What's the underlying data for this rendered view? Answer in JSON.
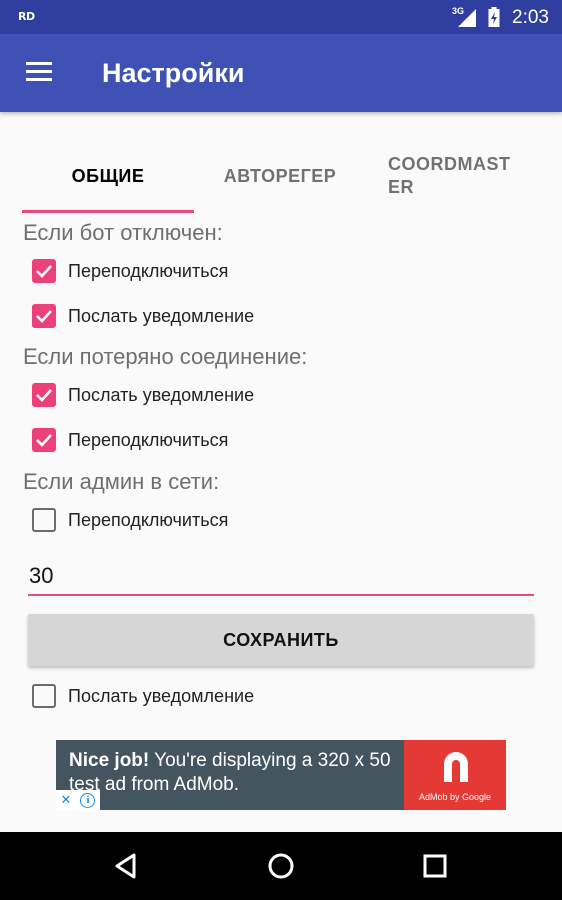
{
  "status_bar": {
    "carrier": "RD",
    "network": "3G",
    "time": "2:03",
    "icons": [
      "signal-icon",
      "battery-icon"
    ]
  },
  "app_bar": {
    "title": "Настройки",
    "menu_icon": "hamburger-menu-icon"
  },
  "tabs": [
    {
      "label": "ОБЩИЕ",
      "active": true
    },
    {
      "label": "АВТОРЕГЕР",
      "active": false
    },
    {
      "label": "COORDMASTER",
      "active": false
    }
  ],
  "sections": {
    "bot_disconnected": {
      "title": "Если бот отключен:",
      "options": [
        {
          "label": "Переподключиться",
          "checked": true
        },
        {
          "label": "Послать уведомление",
          "checked": true
        }
      ]
    },
    "connection_lost": {
      "title": "Если потеряно соединение:",
      "options": [
        {
          "label": "Послать уведомление",
          "checked": true
        },
        {
          "label": "Переподключиться",
          "checked": true
        }
      ]
    },
    "admin_online": {
      "title": "Если админ в сети:",
      "options": [
        {
          "label": "Переподключиться",
          "checked": false
        }
      ]
    }
  },
  "number_input": {
    "value": "30"
  },
  "save_button": {
    "label": "СОХРАНИТЬ"
  },
  "bottom_option": {
    "label": "Послать уведомление",
    "checked": false
  },
  "ad": {
    "headline": "Nice job!",
    "text": "You're displaying a 320 x 50 test ad from AdMob.",
    "caption": "AdMob by Google",
    "close_label": "✕",
    "info_label": "i"
  },
  "colors": {
    "status_bar": "#303f9f",
    "app_bar": "#3f51b5",
    "accent": "#ec407a",
    "ad_background": "#45555f",
    "ad_brand": "#e53935"
  }
}
